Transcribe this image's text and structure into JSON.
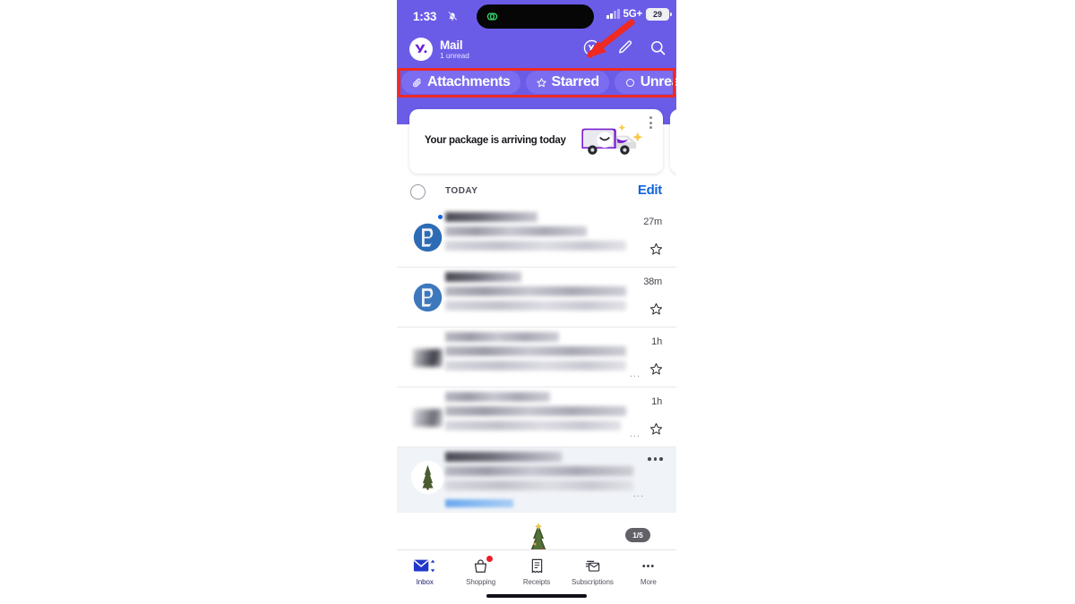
{
  "status_bar": {
    "time": "1:33",
    "bell_icon": "bell-slash-icon",
    "island_icon": "link-activity-icon",
    "signal_icon": "cellular-signal-icon",
    "network": "5G+",
    "battery_level": "29"
  },
  "app_bar": {
    "logo_icon": "yahoo-logo-icon",
    "title": "Mail",
    "subtitle": "1 unread",
    "actions": [
      {
        "name": "yahoo-mini-icon",
        "label": "Yahoo"
      },
      {
        "name": "compose-icon",
        "label": "Compose"
      },
      {
        "name": "search-icon",
        "label": "Search"
      }
    ]
  },
  "filters": {
    "chips": [
      {
        "icon": "paperclip-icon",
        "label": "Attachments"
      },
      {
        "icon": "star-icon",
        "label": "Starred"
      },
      {
        "icon": "circle-icon",
        "label": "Unread"
      }
    ]
  },
  "annotations": {
    "highlight_box": "red-rectangle-around-filter-chips",
    "arrow": "red-arrow-pointing-to-search-icon"
  },
  "promo_card": {
    "title": "Your package is arriving today",
    "illustration": "delivery-truck-icon",
    "menu_icon": "kebab-menu-icon"
  },
  "section": {
    "select_all_icon": "selection-circle-icon",
    "label": "TODAY",
    "edit_label": "Edit"
  },
  "messages": [
    {
      "avatar": "letter-b-logo",
      "unread": true,
      "time": "27m",
      "star_icon": "star-outline-icon",
      "redacted": true
    },
    {
      "avatar": "letter-b-logo",
      "unread": false,
      "time": "38m",
      "star_icon": "star-outline-icon",
      "redacted": true
    },
    {
      "avatar": "grey-logo",
      "unread": false,
      "time": "1h",
      "star_icon": "star-outline-icon",
      "redacted": true
    },
    {
      "avatar": "grey-logo",
      "unread": false,
      "time": "1h",
      "star_icon": "star-outline-icon",
      "redacted": true
    }
  ],
  "promo_message": {
    "avatar": "christmas-tree-icon",
    "menu_icon": "kebab-menu-icon",
    "image": "christmas-tree-image",
    "image_counter": "1/5",
    "redacted": true
  },
  "tab_bar": {
    "tabs": [
      {
        "icon": "inbox-envelope-icon",
        "label": "Inbox",
        "active": true,
        "badge": false
      },
      {
        "icon": "shopping-bag-icon",
        "label": "Shopping",
        "active": false,
        "badge": true
      },
      {
        "icon": "receipt-icon",
        "label": "Receipts",
        "active": false,
        "badge": false
      },
      {
        "icon": "subscriptions-icon",
        "label": "Subscriptions",
        "active": false,
        "badge": false
      },
      {
        "icon": "more-dots-icon",
        "label": "More",
        "active": false,
        "badge": false
      }
    ]
  },
  "colors": {
    "header_purple": "#6b5ce8",
    "chip_purple": "#7b6cf0",
    "accent_blue": "#1264e0",
    "annotation_red": "#ee2a22",
    "badge_red": "#e8202a"
  }
}
